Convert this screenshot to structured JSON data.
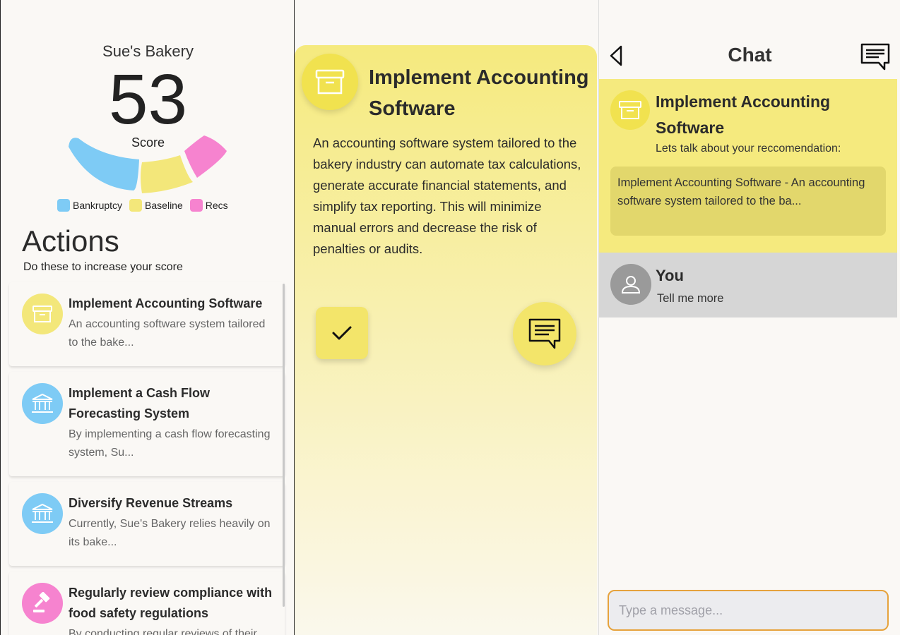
{
  "score_panel": {
    "business_name": "Sue's Bakery",
    "score": "53",
    "score_label": "Score",
    "gauge": {
      "segments": [
        {
          "name": "Bankruptcy",
          "color": "#7ecbf5"
        },
        {
          "name": "Baseline",
          "color": "#f3e77a"
        },
        {
          "name": "Recs",
          "color": "#f683cf"
        }
      ]
    },
    "legend": [
      {
        "label": "Bankruptcy",
        "color": "#7ecbf5"
      },
      {
        "label": "Baseline",
        "color": "#f3e77a"
      },
      {
        "label": "Recs",
        "color": "#f683cf"
      }
    ],
    "actions_title": "Actions",
    "actions_subtitle": "Do these to increase your score",
    "actions": [
      {
        "title": "Implement Accounting Software",
        "desc": "An accounting software system tailored to the bake...",
        "icon": "archive-box-icon",
        "color": "#f3e77a"
      },
      {
        "title": "Implement a Cash Flow Forecasting System",
        "desc": "By implementing a cash flow forecasting system, Su...",
        "icon": "bank-icon",
        "color": "#7ecbf5"
      },
      {
        "title": "Diversify Revenue Streams",
        "desc": "Currently, Sue's Bakery relies heavily on its bake...",
        "icon": "bank-icon",
        "color": "#7ecbf5"
      },
      {
        "title": "Regularly review compliance with food safety regulations",
        "desc": "By conducting regular reviews of their",
        "icon": "gavel-icon",
        "color": "#f683cf"
      }
    ]
  },
  "detail_panel": {
    "title": "Implement Accounting Software",
    "description": "An accounting software system tailored to the bakery industry can automate tax calculations, generate accurate financial statements, and simplify tax reporting. This will minimize manual errors and decrease the risk of penalties or audits.",
    "accent_color": "#f1e24f"
  },
  "chat_panel": {
    "title": "Chat",
    "rec_title": "Implement Accounting Software",
    "rec_subtitle": "Lets talk about your reccomendation:",
    "rec_preview": "Implement Accounting Software - An accounting software system tailored to the ba...",
    "messages": [
      {
        "sender": "You",
        "text": "Tell me more"
      }
    ],
    "input_placeholder": "Type a message...",
    "input_border_color": "#e6a23c"
  }
}
